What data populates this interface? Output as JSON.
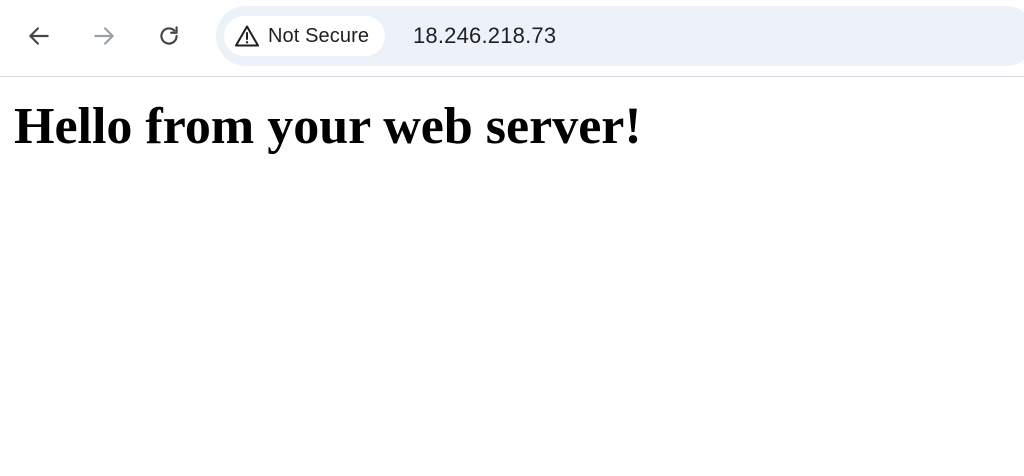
{
  "browser": {
    "nav": {
      "back_icon": "arrow-left-icon",
      "forward_icon": "arrow-right-icon",
      "reload_icon": "reload-icon"
    },
    "security_chip": {
      "icon": "warning-triangle-icon",
      "label": "Not Secure"
    },
    "address": "18.246.218.73",
    "colors": {
      "omnibox_bg": "#edf2fa",
      "chip_bg": "#ffffff",
      "icon_active": "#474747",
      "icon_disabled": "#9aa0a6"
    }
  },
  "page": {
    "heading": "Hello from your web server!"
  }
}
